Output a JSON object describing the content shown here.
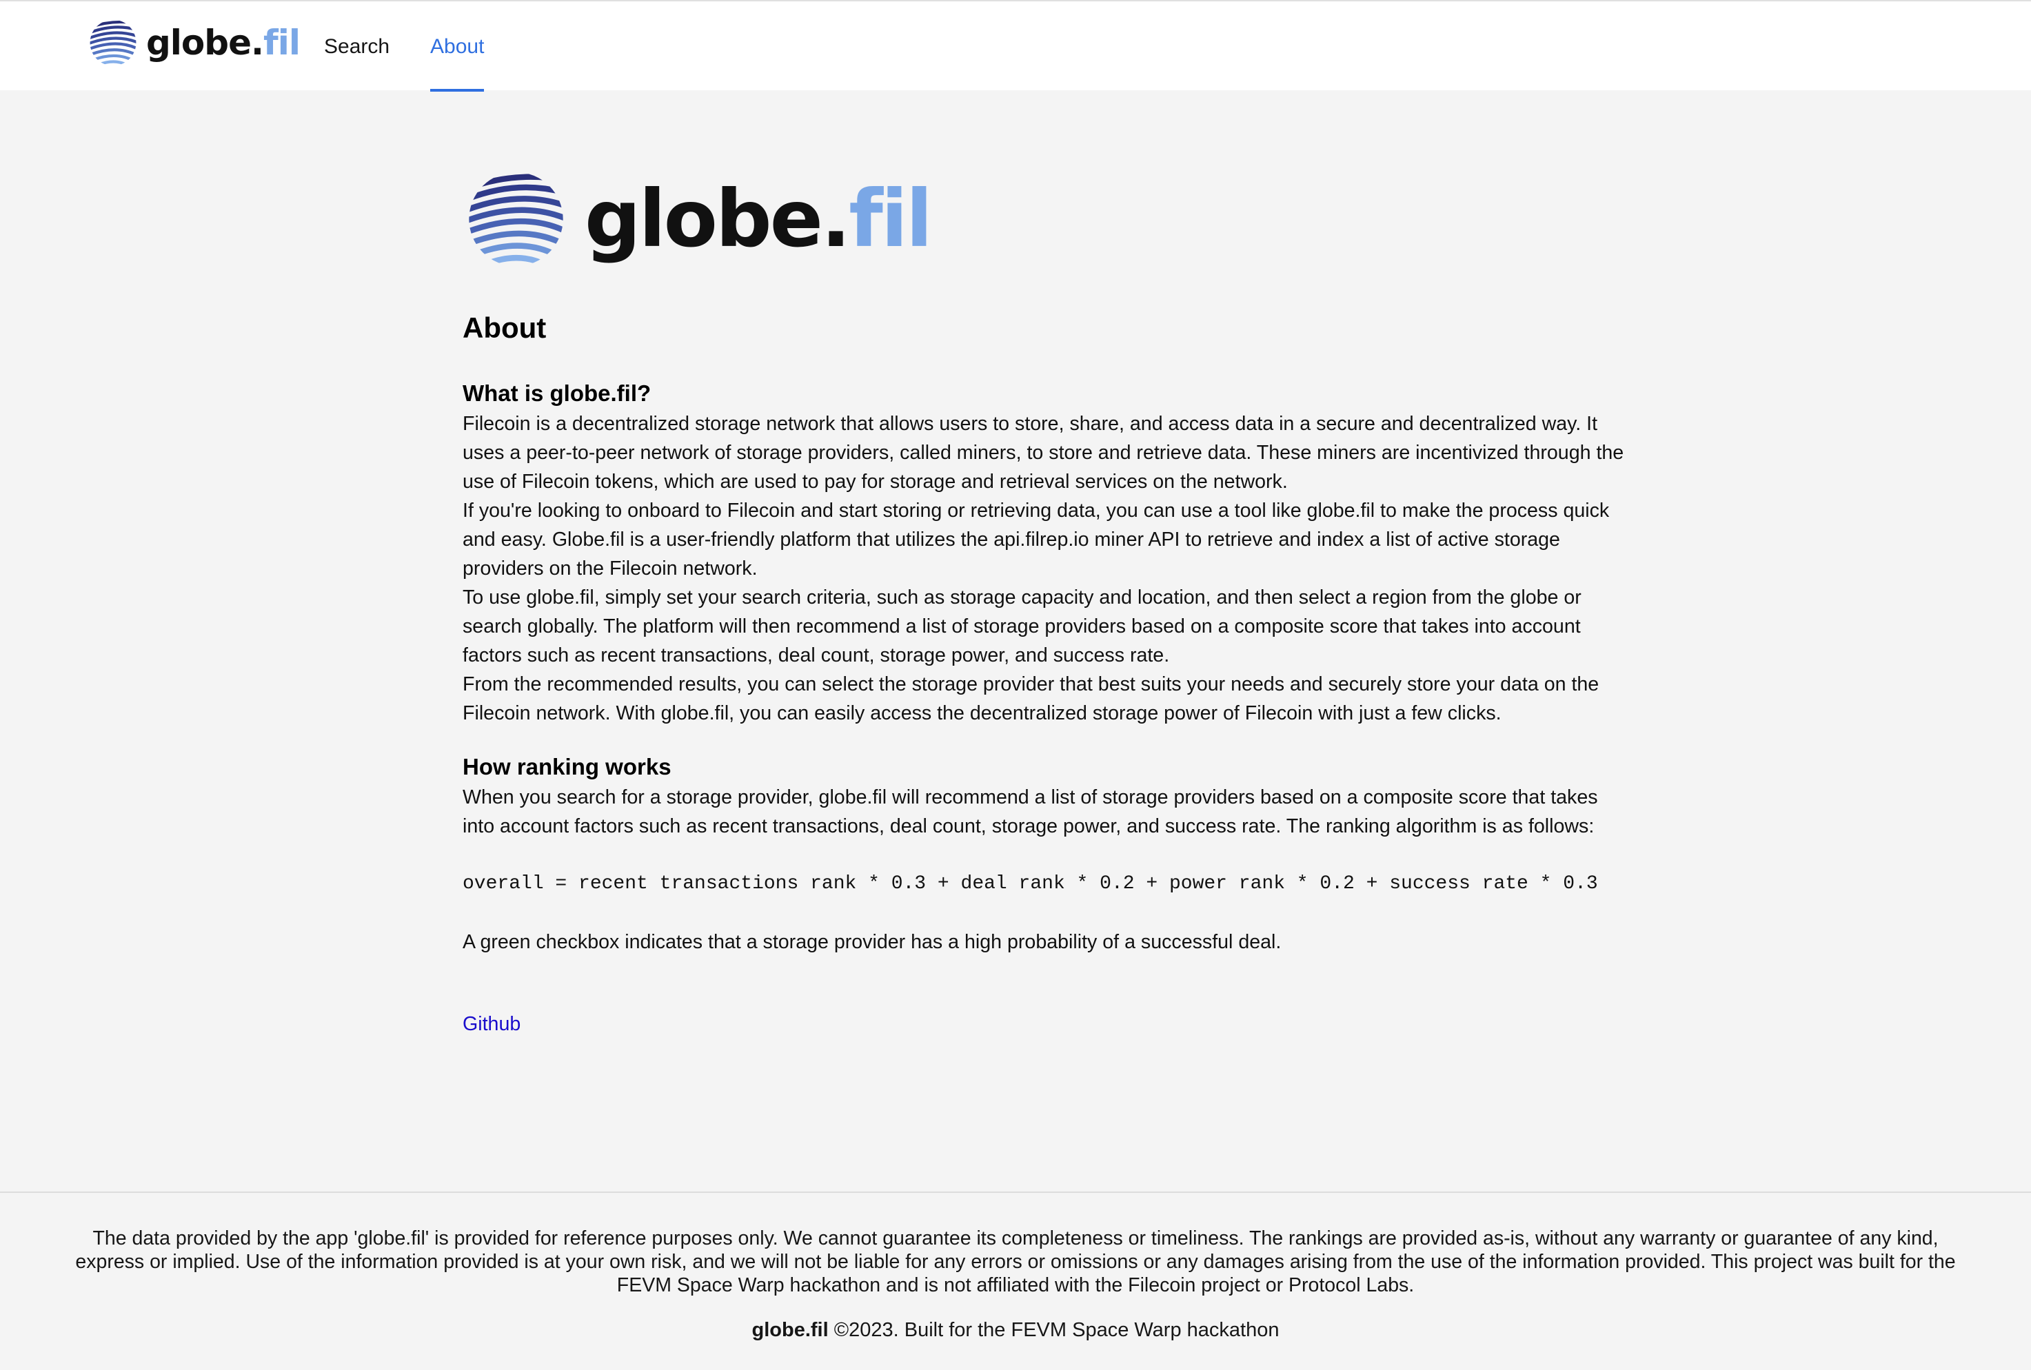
{
  "header": {
    "brand": {
      "name_main": "globe.",
      "name_accent": "fil",
      "logo_icon": "striped-globe-icon"
    },
    "nav": [
      {
        "label": "Search",
        "active": false
      },
      {
        "label": "About",
        "active": true
      }
    ]
  },
  "hero": {
    "name_main": "globe.",
    "name_accent": "fil",
    "logo_icon": "striped-globe-icon"
  },
  "page": {
    "title": "About",
    "sections": [
      {
        "heading": "What is globe.fil?",
        "paragraphs": [
          "Filecoin is a decentralized storage network that allows users to store, share, and access data in a secure and decentralized way. It uses a peer-to-peer network of storage providers, called miners, to store and retrieve data. These miners are incentivized through the use of Filecoin tokens, which are used to pay for storage and retrieval services on the network.",
          "If you're looking to onboard to Filecoin and start storing or retrieving data, you can use a tool like globe.fil to make the process quick and easy. Globe.fil is a user-friendly platform that utilizes the api.filrep.io miner API to retrieve and index a list of active storage providers on the Filecoin network.",
          "To use globe.fil, simply set your search criteria, such as storage capacity and location, and then select a region from the globe or search globally. The platform will then recommend a list of storage providers based on a composite score that takes into account factors such as recent transactions, deal count, storage power, and success rate.",
          "From the recommended results, you can select the storage provider that best suits your needs and securely store your data on the Filecoin network. With globe.fil, you can easily access the decentralized storage power of Filecoin with just a few clicks."
        ]
      },
      {
        "heading": "How ranking works",
        "paragraphs": [
          "When you search for a storage provider, globe.fil will recommend a list of storage providers based on a composite score that takes into account factors such as recent transactions, deal count, storage power, and success rate. The ranking algorithm is as follows:"
        ],
        "formula": "overall = recent transactions rank * 0.3 + deal rank * 0.2 + power rank * 0.2 + success rate * 0.3",
        "note": "A green checkbox indicates that a storage provider has a high probability of a successful deal."
      }
    ],
    "github_label": "Github"
  },
  "footer": {
    "disclaimer": "The data provided by the app 'globe.fil' is provided for reference purposes only. We cannot guarantee its completeness or timeliness. The rankings are provided as-is, without any warranty or guarantee of any kind, express or implied. Use of the information provided is at your own risk, and we will not be liable for any errors or omissions or any damages arising from the use of the information provided. This project was built for the FEVM Space Warp hackathon and is not affiliated with the Filecoin project or Protocol Labs.",
    "brand": "globe.fil",
    "copyright": " ©2023. Built for the FEVM Space Warp hackathon"
  },
  "colors": {
    "accent_blue": "#2f6fe0",
    "brand_light_blue": "#7aa7e6",
    "link_blue": "#1a0dcc",
    "background": "#f4f4f4",
    "header_bg": "#ffffff"
  }
}
